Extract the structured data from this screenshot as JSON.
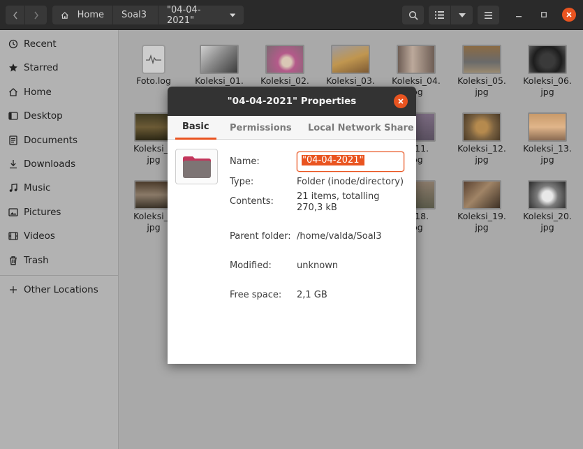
{
  "header": {
    "breadcrumbs": [
      "Home",
      "Soal3",
      "\"04-04-2021\""
    ]
  },
  "sidebar": {
    "items": [
      {
        "label": "Recent",
        "icon": "clock-icon"
      },
      {
        "label": "Starred",
        "icon": "star-icon"
      },
      {
        "label": "Home",
        "icon": "home-icon"
      },
      {
        "label": "Desktop",
        "icon": "desktop-icon"
      },
      {
        "label": "Documents",
        "icon": "document-icon"
      },
      {
        "label": "Downloads",
        "icon": "download-icon"
      },
      {
        "label": "Music",
        "icon": "music-icon"
      },
      {
        "label": "Pictures",
        "icon": "picture-icon"
      },
      {
        "label": "Videos",
        "icon": "video-icon"
      },
      {
        "label": "Trash",
        "icon": "trash-icon"
      }
    ],
    "other_locations": "Other Locations"
  },
  "files": [
    {
      "line1": "Foto.log",
      "line2": ""
    },
    {
      "line1": "Koleksi_01.",
      "line2": ""
    },
    {
      "line1": "Koleksi_02.",
      "line2": ""
    },
    {
      "line1": "Koleksi_03.",
      "line2": ""
    },
    {
      "line1": "Koleksi_04.",
      "line2": "jpg"
    },
    {
      "line1": "Koleksi_05.",
      "line2": "jpg"
    },
    {
      "line1": "Koleksi_06.",
      "line2": "jpg"
    },
    {
      "line1": "Koleksi_0",
      "line2": "jpg"
    },
    {
      "line1": "si_11.",
      "line2": "jpg"
    },
    {
      "line1": "Koleksi_12.",
      "line2": "jpg"
    },
    {
      "line1": "Koleksi_13.",
      "line2": "jpg"
    },
    {
      "line1": "Koleksi_1",
      "line2": "jpg"
    },
    {
      "line1": "si_18.",
      "line2": "jpg"
    },
    {
      "line1": "Koleksi_19.",
      "line2": "jpg"
    },
    {
      "line1": "Koleksi_20.",
      "line2": "jpg"
    }
  ],
  "dialog": {
    "title": "\"04-04-2021\" Properties",
    "tabs": [
      "Basic",
      "Permissions",
      "Local Network Share"
    ],
    "name_label": "Name:",
    "name_value": "\"04-04-2021\"",
    "type_label": "Type:",
    "type_value": "Folder (inode/directory)",
    "contents_label": "Contents:",
    "contents_value_1": "21 items, totalling",
    "contents_value_2": "270,3 kB",
    "parent_label": "Parent folder:",
    "parent_value": "/home/valda/Soal3",
    "modified_label": "Modified:",
    "modified_value": "unknown",
    "free_label": "Free space:",
    "free_value": "2,1 GB"
  },
  "colors": {
    "accent": "#e95420",
    "headerbar": "#2a2a2a",
    "dim_background": "#a9a9a9",
    "folder": "#7d7474",
    "folder_tab": "#c2355b"
  }
}
